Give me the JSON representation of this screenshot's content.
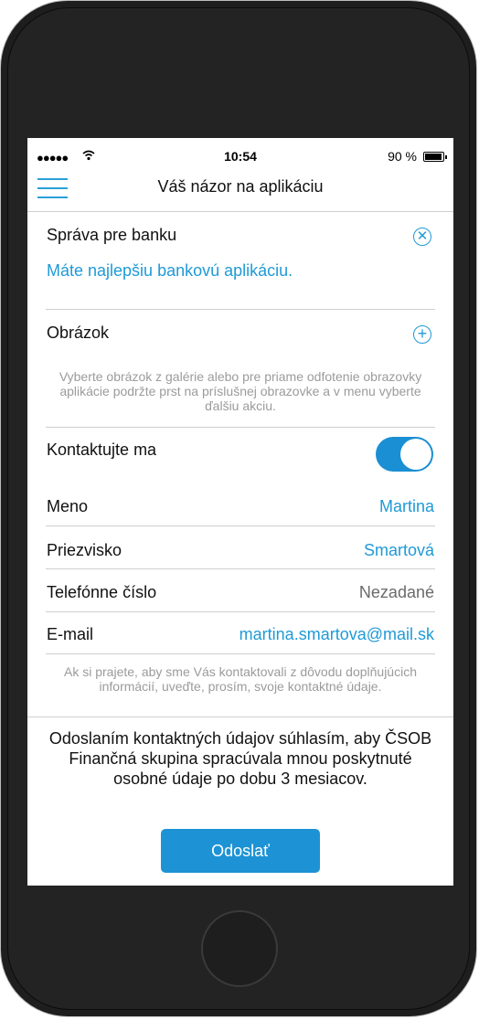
{
  "status_bar": {
    "time": "10:54",
    "battery": "90 %"
  },
  "nav": {
    "title": "Váš názor na aplikáciu"
  },
  "message": {
    "label": "Správa pre banku",
    "value": "Máte najlepšiu bankovú aplikáciu."
  },
  "image": {
    "label": "Obrázok",
    "hint": "Vyberte obrázok z galérie alebo pre priame odfotenie obrazovky aplikácie podržte prst na príslušnej obrazovke a v menu vyberte ďalšiu akciu."
  },
  "contact": {
    "label": "Kontaktujte ma",
    "enabled": true
  },
  "fields": [
    {
      "label": "Meno",
      "value": "Martina"
    },
    {
      "label": "Priezvisko",
      "value": "Smartová"
    },
    {
      "label": "Telefónne číslo",
      "value": "Nezadané"
    },
    {
      "label": "E-mail",
      "value": "martina.smartova@mail.sk"
    }
  ],
  "contact_hint": "Ak si prajete, aby sme Vás kontaktovali z dôvodu doplňujúcich informácií, uveďte, prosím, svoje kontaktné údaje.",
  "consent": "Odoslaním kontaktných údajov súhlasím, aby ČSOB Finančná skupina spracúvala mnou poskytnuté osobné údaje po dobu 3 mesiacov.",
  "submit_label": "Odoslať",
  "colors": {
    "accent": "#1f9ad6",
    "toggle_on": "#1a8fd3"
  },
  "icons": {
    "menu": "hamburger-icon",
    "clear": "clear-x-icon",
    "add": "add-plus-icon",
    "wifi": "wifi-icon",
    "battery": "battery-icon"
  }
}
